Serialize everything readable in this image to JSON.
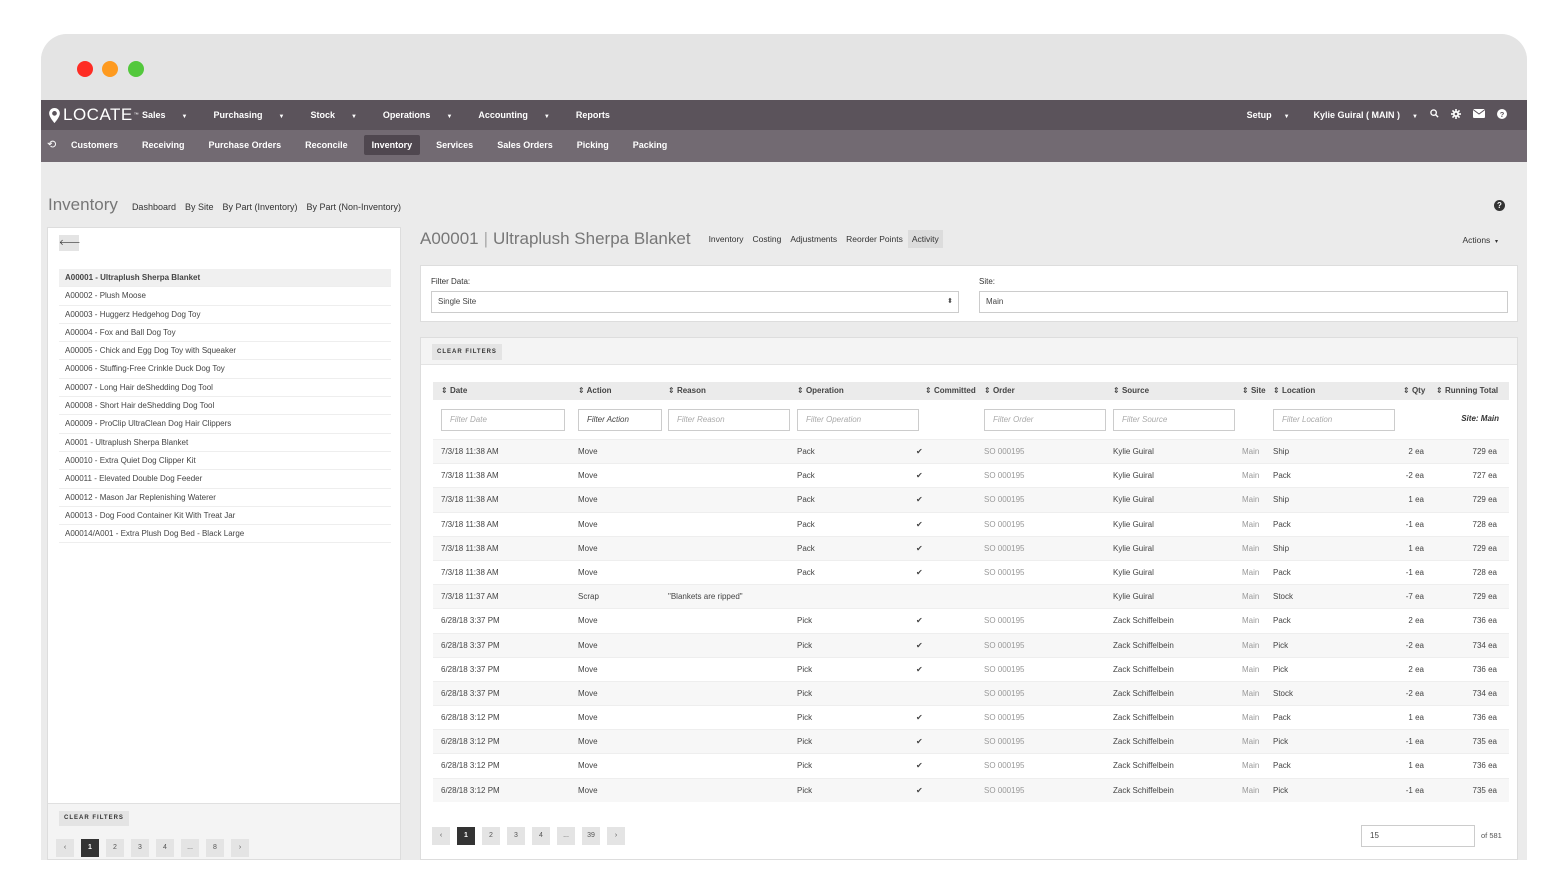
{
  "nav": {
    "logo": "LOCATE",
    "logo_tm": "™",
    "menu": [
      {
        "label": "Sales",
        "caret": true
      },
      {
        "label": "Purchasing",
        "caret": true
      },
      {
        "label": "Stock",
        "caret": true
      },
      {
        "label": "Operations",
        "caret": true
      },
      {
        "label": "Accounting",
        "caret": true
      },
      {
        "label": "Reports",
        "caret": false
      }
    ],
    "setup": "Setup",
    "user": "Kylie Guiral ( MAIN )"
  },
  "subnav": {
    "items": [
      "Customers",
      "Receiving",
      "Purchase Orders",
      "Reconcile",
      "Inventory",
      "Services",
      "Sales Orders",
      "Picking",
      "Packing"
    ],
    "active": "Inventory"
  },
  "page": {
    "title": "Inventory",
    "links": [
      "Dashboard",
      "By Site",
      "By Part (Inventory)",
      "By Part (Non-Inventory)"
    ]
  },
  "sidebar": {
    "items": [
      "A00001 - Ultraplush Sherpa Blanket",
      "A00002 - Plush Moose",
      "A00003 - Huggerz Hedgehog Dog Toy",
      "A00004 - Fox and Ball Dog Toy",
      "A00005 - Chick and Egg Dog Toy with Squeaker",
      "A00006 - Stuffing-Free Crinkle Duck Dog Toy",
      "A00007 - Long Hair deShedding Dog Tool",
      "A00008 - Short Hair deShedding Dog Tool",
      "A00009 - ProClip UltraClean Dog Hair Clippers",
      "A0001 - Ultraplush Sherpa Blanket",
      "A00010 - Extra Quiet Dog Clipper Kit",
      "A00011 - Elevated Double Dog Feeder",
      "A00012 - Mason Jar Replenishing Waterer",
      "A00013 - Dog Food Container Kit With Treat Jar",
      "A00014/A001 - Extra Plush Dog Bed - Black Large"
    ],
    "selected_index": 0,
    "clear_filters": "CLEAR FILTERS",
    "pager": [
      "‹",
      "1",
      "2",
      "3",
      "4",
      "...",
      "8",
      "›"
    ],
    "pager_active": "1"
  },
  "detail": {
    "part_no": "A00001",
    "part_name": "Ultraplush Sherpa Blanket",
    "separator": "|",
    "tabs": [
      "Inventory",
      "Costing",
      "Adjustments",
      "Reorder Points",
      "Activity"
    ],
    "active_tab": "Activity",
    "actions": "Actions",
    "filter_data_label": "Filter Data:",
    "filter_data_value": "Single Site",
    "site_label": "Site:",
    "site_value": "Main"
  },
  "table": {
    "clear_filters": "CLEAR FILTERS",
    "columns": [
      {
        "key": "date",
        "label": "Date"
      },
      {
        "key": "action",
        "label": "Action"
      },
      {
        "key": "reason",
        "label": "Reason"
      },
      {
        "key": "operation",
        "label": "Operation"
      },
      {
        "key": "committed",
        "label": "Committed"
      },
      {
        "key": "order",
        "label": "Order"
      },
      {
        "key": "source",
        "label": "Source"
      },
      {
        "key": "site",
        "label": "Site"
      },
      {
        "key": "location",
        "label": "Location"
      },
      {
        "key": "qty",
        "label": "Qty"
      },
      {
        "key": "running_total",
        "label": "Running Total"
      }
    ],
    "filters": {
      "date": "Filter Date",
      "action": "Filter Action",
      "reason": "Filter Reason",
      "operation": "Filter Operation",
      "order": "Filter Order",
      "source": "Filter Source",
      "location": "Filter Location",
      "site_note": "Site: Main"
    },
    "rows": [
      [
        "7/3/18 11:38 AM",
        "Move",
        "",
        "Pack",
        "✔",
        "SO 000195",
        "Kylie Guiral",
        "Main",
        "Ship",
        "2 ea",
        "729 ea"
      ],
      [
        "7/3/18 11:38 AM",
        "Move",
        "",
        "Pack",
        "✔",
        "SO 000195",
        "Kylie Guiral",
        "Main",
        "Pack",
        "-2 ea",
        "727 ea"
      ],
      [
        "7/3/18 11:38 AM",
        "Move",
        "",
        "Pack",
        "✔",
        "SO 000195",
        "Kylie Guiral",
        "Main",
        "Ship",
        "1 ea",
        "729 ea"
      ],
      [
        "7/3/18 11:38 AM",
        "Move",
        "",
        "Pack",
        "✔",
        "SO 000195",
        "Kylie Guiral",
        "Main",
        "Pack",
        "-1 ea",
        "728 ea"
      ],
      [
        "7/3/18 11:38 AM",
        "Move",
        "",
        "Pack",
        "✔",
        "SO 000195",
        "Kylie Guiral",
        "Main",
        "Ship",
        "1 ea",
        "729 ea"
      ],
      [
        "7/3/18 11:38 AM",
        "Move",
        "",
        "Pack",
        "✔",
        "SO 000195",
        "Kylie Guiral",
        "Main",
        "Pack",
        "-1 ea",
        "728 ea"
      ],
      [
        "7/3/18 11:37 AM",
        "Scrap",
        "\"Blankets are ripped\"",
        "",
        "",
        "",
        "Kylie Guiral",
        "Main",
        "Stock",
        "-7 ea",
        "729 ea"
      ],
      [
        "6/28/18 3:37 PM",
        "Move",
        "",
        "Pick",
        "✔",
        "SO 000195",
        "Zack Schiffelbein",
        "Main",
        "Pack",
        "2 ea",
        "736 ea"
      ],
      [
        "6/28/18 3:37 PM",
        "Move",
        "",
        "Pick",
        "✔",
        "SO 000195",
        "Zack Schiffelbein",
        "Main",
        "Pick",
        "-2 ea",
        "734 ea"
      ],
      [
        "6/28/18 3:37 PM",
        "Move",
        "",
        "Pick",
        "✔",
        "SO 000195",
        "Zack Schiffelbein",
        "Main",
        "Pick",
        "2 ea",
        "736 ea"
      ],
      [
        "6/28/18 3:37 PM",
        "Move",
        "",
        "Pick",
        "",
        "SO 000195",
        "Zack Schiffelbein",
        "Main",
        "Stock",
        "-2 ea",
        "734 ea"
      ],
      [
        "6/28/18 3:12 PM",
        "Move",
        "",
        "Pick",
        "✔",
        "SO 000195",
        "Zack Schiffelbein",
        "Main",
        "Pack",
        "1 ea",
        "736 ea"
      ],
      [
        "6/28/18 3:12 PM",
        "Move",
        "",
        "Pick",
        "✔",
        "SO 000195",
        "Zack Schiffelbein",
        "Main",
        "Pick",
        "-1 ea",
        "735 ea"
      ],
      [
        "6/28/18 3:12 PM",
        "Move",
        "",
        "Pick",
        "✔",
        "SO 000195",
        "Zack Schiffelbein",
        "Main",
        "Pack",
        "1 ea",
        "736 ea"
      ],
      [
        "6/28/18 3:12 PM",
        "Move",
        "",
        "Pick",
        "✔",
        "SO 000195",
        "Zack Schiffelbein",
        "Main",
        "Pick",
        "-1 ea",
        "735 ea"
      ]
    ],
    "pager": [
      "‹",
      "1",
      "2",
      "3",
      "4",
      "...",
      "39",
      "›"
    ],
    "pager_active": "1",
    "per_page": "15",
    "total": "of 581"
  }
}
